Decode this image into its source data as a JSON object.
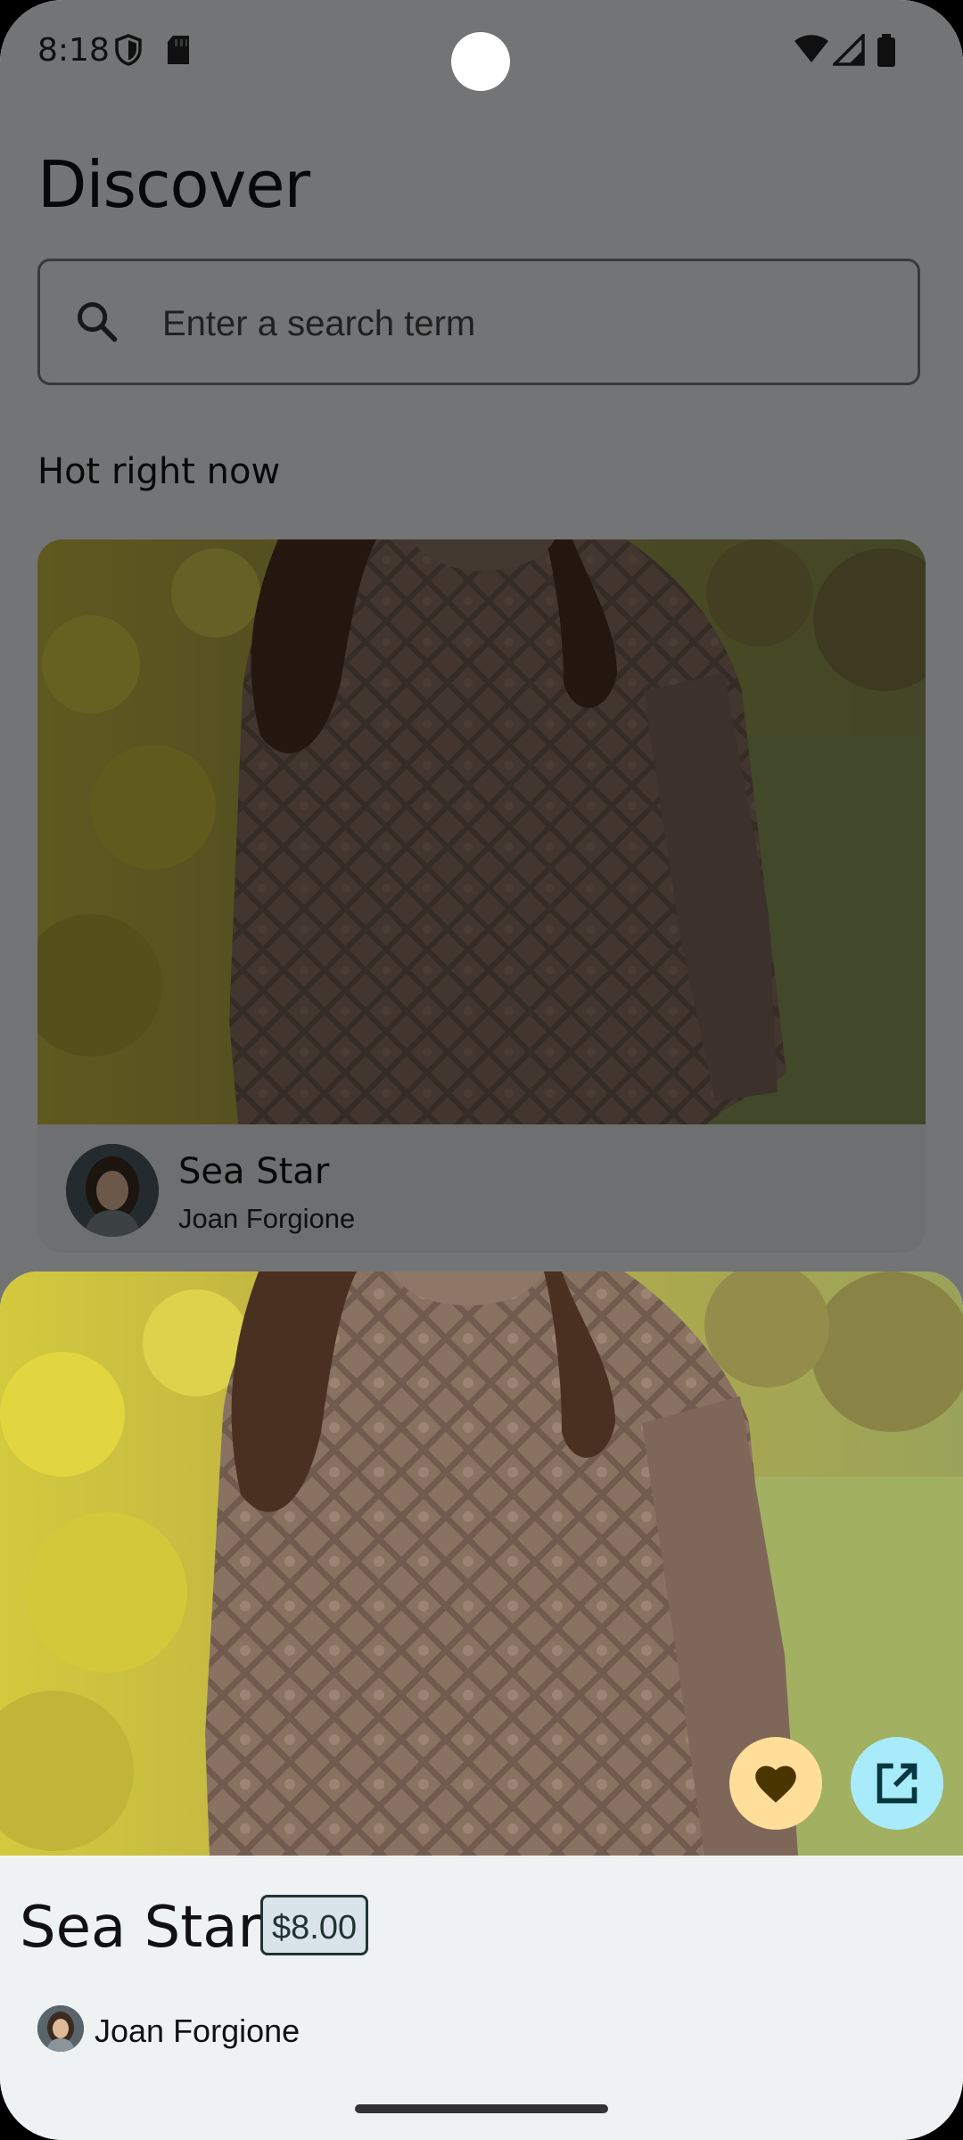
{
  "status_bar": {
    "time": "8:18",
    "icons": [
      "shield-icon",
      "sd-card-icon",
      "wifi-icon",
      "signal-icon",
      "battery-icon"
    ]
  },
  "page": {
    "title": "Discover",
    "search": {
      "placeholder": "Enter a search term",
      "value": "",
      "icon": "search-icon"
    },
    "section_label": "Hot right now",
    "card": {
      "title": "Sea Star",
      "author": "Joan Forgione"
    }
  },
  "sheet": {
    "title": "Sea Star",
    "price": "$8.00",
    "author": "Joan Forgione",
    "actions": {
      "like_icon": "heart-icon",
      "open_icon": "open-in-new-icon"
    }
  },
  "colors": {
    "like_button": "#ffde9a",
    "open_button": "#a8ecfb",
    "sheet_background": "#eef2f3",
    "price_badge": "#d9e4ea"
  }
}
